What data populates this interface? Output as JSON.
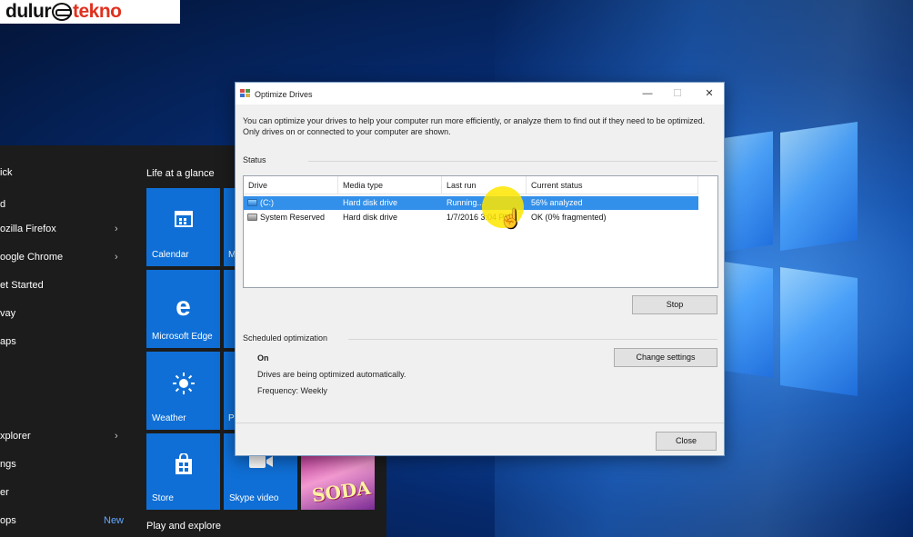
{
  "watermark": {
    "part1": "dulur",
    "part2": "tekno"
  },
  "start_menu": {
    "left_items": [
      {
        "label": "ick",
        "chevron": ""
      },
      {
        "label": "d",
        "chevron": ""
      },
      {
        "label": "ozilla Firefox",
        "chevron": "›"
      },
      {
        "label": "oogle Chrome",
        "chevron": "›"
      },
      {
        "label": "et Started",
        "chevron": ""
      },
      {
        "label": "vay",
        "chevron": ""
      },
      {
        "label": "aps",
        "chevron": ""
      },
      {
        "label": "xplorer",
        "chevron": "›"
      },
      {
        "label": "ngs",
        "chevron": ""
      },
      {
        "label": "er",
        "chevron": ""
      },
      {
        "label": "ops",
        "chevron": "",
        "badge": "New"
      }
    ],
    "group_life": "Life at a glance",
    "group_play": "Play and explore",
    "tiles": {
      "calendar": "Calendar",
      "calendar_partial": "M",
      "edge": "Microsoft Edge",
      "weather": "Weather",
      "weather_partial": "P",
      "store": "Store",
      "skype": "Skype video",
      "candy": "SODA"
    }
  },
  "dialog": {
    "title": "Optimize Drives",
    "description": "You can optimize your drives to help your computer run more efficiently, or analyze them to find out if they need to be optimized. Only drives on or connected to your computer are shown.",
    "status_label": "Status",
    "columns": [
      "Drive",
      "Media type",
      "Last run",
      "Current status"
    ],
    "rows": [
      {
        "drive": "(C:)",
        "media": "Hard disk drive",
        "last_run": "Running...",
        "status": "56% analyzed",
        "selected": true
      },
      {
        "drive": "System Reserved",
        "media": "Hard disk drive",
        "last_run": "1/7/2016 3:04 PM",
        "status": "OK (0% fragmented)",
        "selected": false
      }
    ],
    "stop_button": "Stop",
    "scheduled_label": "Scheduled optimization",
    "sched_state": "On",
    "sched_line1": "Drives are being optimized automatically.",
    "sched_line2": "Frequency: Weekly",
    "change_settings_button": "Change settings",
    "close_button": "Close",
    "window_controls": {
      "minimize": "—",
      "maximize": "☐",
      "close": "✕"
    }
  },
  "colors": {
    "selection": "#3390ea",
    "tile_blue": "#0f6fd6",
    "cursor_halo": "#ffe600"
  }
}
